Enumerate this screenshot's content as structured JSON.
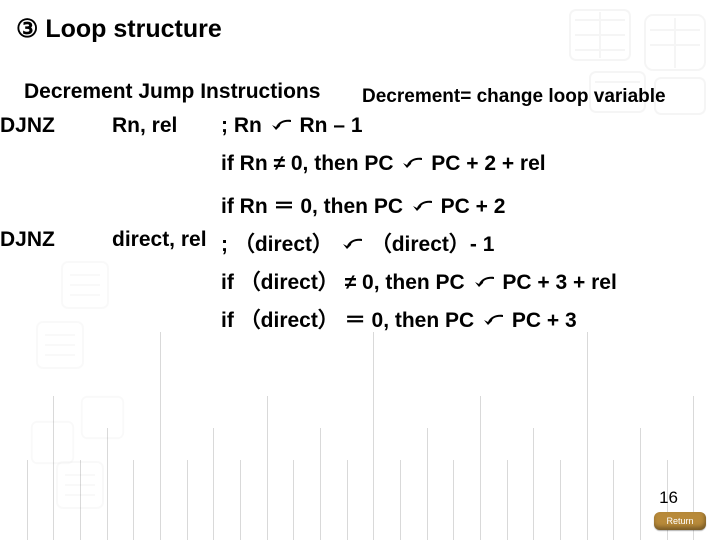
{
  "title": "③ Loop structure",
  "heading": "Decrement Jump Instructions",
  "subnote": "Decrement= change loop variable",
  "rows": {
    "r1_mnem": "DJNZ",
    "r1_op": "Rn,  rel",
    "r1_desc_a": ";  Rn ",
    "r1_desc_b": " Rn – 1",
    "r2_desc_a": "if  Rn ≠ 0,  then  PC  ",
    "r2_desc_b": "  PC + 2 + rel",
    "r3_desc_a": "if  Rn ＝ 0,  then  PC  ",
    "r3_desc_b": "  PC + 2",
    "r4_mnem": "DJNZ",
    "r4_op": "direct, rel",
    "r4_desc_a": ";  （direct） ",
    "r4_desc_b": " （direct）- 1",
    "r5_desc_a": "if （direct） ≠ 0,  then  PC  ",
    "r5_desc_b": "  PC + 3 + rel",
    "r6_desc_a": "if （direct） ＝ 0,  then  PC  ",
    "r6_desc_b": "  PC + 3"
  },
  "pageNumber": "16",
  "returnLabel": "Return"
}
